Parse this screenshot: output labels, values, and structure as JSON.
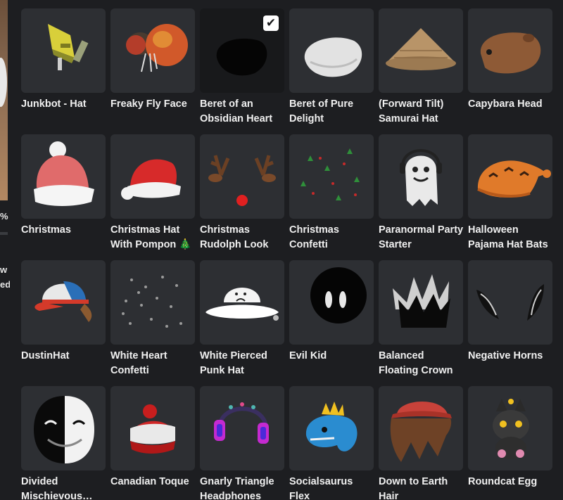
{
  "left_panel": {
    "percent_text": "%",
    "partial_label_1": "w",
    "partial_label_2": "ed"
  },
  "items": [
    {
      "name": "Junkbot - Hat",
      "icon": "junkbot-hat-icon"
    },
    {
      "name": "Freaky Fly Face",
      "icon": "fly-face-icon"
    },
    {
      "name": "Beret of an Obsidian Heart",
      "icon": "black-beret-icon",
      "selected": true
    },
    {
      "name": "Beret of Pure Delight",
      "icon": "white-beret-icon"
    },
    {
      "name": "(Forward Tilt) Samurai Hat",
      "icon": "samurai-hat-icon"
    },
    {
      "name": "Capybara Head",
      "icon": "capybara-head-icon"
    },
    {
      "name": "Christmas",
      "icon": "knit-hat-icon"
    },
    {
      "name": "Christmas Hat With Pompon 🎄",
      "icon": "santa-hat-icon"
    },
    {
      "name": "Christmas Rudolph Look",
      "icon": "reindeer-antlers-icon"
    },
    {
      "name": "Christmas Confetti",
      "icon": "confetti-icon"
    },
    {
      "name": "Paranormal Party Starter",
      "icon": "ghost-headphones-icon"
    },
    {
      "name": "Halloween Pajama Hat Bats",
      "icon": "pajama-hat-icon"
    },
    {
      "name": "DustinHat",
      "icon": "trucker-cap-icon"
    },
    {
      "name": "White Heart Confetti",
      "icon": "heart-confetti-icon"
    },
    {
      "name": "White Pierced Punk Hat",
      "icon": "bucket-hat-icon"
    },
    {
      "name": "Evil Kid",
      "icon": "black-head-icon"
    },
    {
      "name": "Balanced Floating Crown",
      "icon": "crown-icon"
    },
    {
      "name": "Negative Horns",
      "icon": "horns-icon"
    },
    {
      "name": "Divided Mischievous…",
      "icon": "divided-face-icon"
    },
    {
      "name": "Canadian Toque",
      "icon": "toque-icon"
    },
    {
      "name": "Gnarly Triangle Headphones",
      "icon": "headphones-icon"
    },
    {
      "name": "Socialsaurus Flex",
      "icon": "dinosaur-icon"
    },
    {
      "name": "Down to Earth Hair",
      "icon": "hair-icon"
    },
    {
      "name": "Roundcat Egg",
      "icon": "cat-egg-icon"
    }
  ],
  "check_glyph": "✔"
}
